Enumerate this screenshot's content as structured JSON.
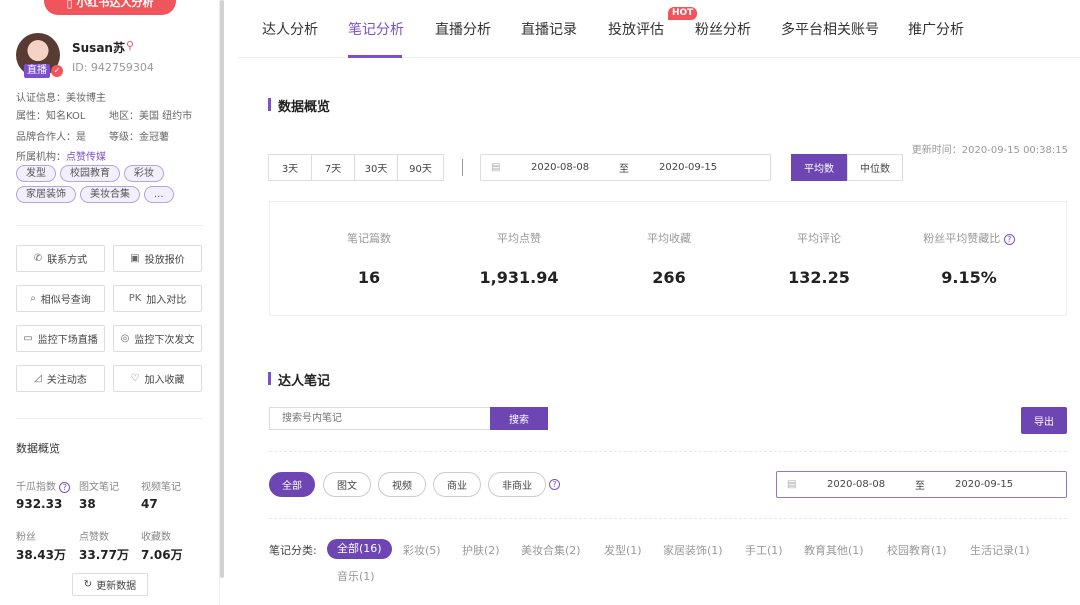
{
  "sidebar": {
    "top_button": "小红书达人分析",
    "profile": {
      "name": "Susan苏",
      "id": "ID: 942759304",
      "live_badge": "直播"
    },
    "info": {
      "cert": {
        "label": "认证信息：",
        "value": "美妆博主"
      },
      "attr": {
        "label": "属性：",
        "value": "知名KOL"
      },
      "region": {
        "label": "地区：",
        "value": "美国 纽约市"
      },
      "brand": {
        "label": "品牌合作人：",
        "value": "是"
      },
      "level": {
        "label": "等级：",
        "value": "金冠薯"
      },
      "org": {
        "label": "所属机构：",
        "value": "点赞传媒"
      }
    },
    "tags": [
      "发型",
      "校园教育",
      "彩妆",
      "家居装饰",
      "美妆合集",
      "..."
    ],
    "buttons": {
      "contact": "联系方式",
      "quote": "投放报价",
      "similar": "相似号查询",
      "compare": "加入对比",
      "monitor_live": "监控下场直播",
      "monitor_post": "监控下次发文",
      "follow": "关注动态",
      "favorite": "加入收藏"
    },
    "data_overview": {
      "title": "数据概览",
      "stats": [
        {
          "label": "千瓜指数",
          "value": "932.33"
        },
        {
          "label": "图文笔记",
          "value": "38"
        },
        {
          "label": "视频笔记",
          "value": "47"
        },
        {
          "label": "粉丝",
          "value": "38.43万"
        },
        {
          "label": "点赞数",
          "value": "33.77万"
        },
        {
          "label": "收藏数",
          "value": "7.06万"
        }
      ],
      "refresh": "更新数据"
    }
  },
  "tabs": [
    {
      "label": "达人分析"
    },
    {
      "label": "笔记分析"
    },
    {
      "label": "直播分析"
    },
    {
      "label": "直播记录"
    },
    {
      "label": "投放评估"
    },
    {
      "label": "粉丝分析"
    },
    {
      "label": "多平台相关账号"
    },
    {
      "label": "推广分析"
    }
  ],
  "hot_badge": "HOT",
  "overview": {
    "title": "数据概览",
    "updated": "更新时间：2020-09-15 00:38:15",
    "ranges": [
      "3天",
      "7天",
      "30天",
      "90天"
    ],
    "date_from": "2020-08-08",
    "date_sep": "至",
    "date_to": "2020-09-15",
    "modes": [
      "平均数",
      "中位数"
    ],
    "metrics": [
      {
        "label": "笔记篇数",
        "value": "16"
      },
      {
        "label": "平均点赞",
        "value": "1,931.94"
      },
      {
        "label": "平均收藏",
        "value": "266"
      },
      {
        "label": "平均评论",
        "value": "132.25"
      },
      {
        "label": "粉丝平均赞藏比",
        "value": "9.15%"
      }
    ]
  },
  "notes": {
    "title": "达人笔记",
    "search_placeholder": "搜索号内笔记",
    "search_btn": "搜索",
    "export_btn": "导出",
    "filters": [
      "全部",
      "图文",
      "视频",
      "商业",
      "非商业"
    ],
    "date_from": "2020-08-08",
    "date_sep": "至",
    "date_to": "2020-09-15",
    "category_label": "笔记分类:",
    "categories": [
      "全部(16)",
      "彩妆(5)",
      "护肤(2)",
      "美妆合集(2)",
      "发型(1)",
      "家居装饰(1)",
      "手工(1)",
      "教育其他(1)",
      "校园教育(1)",
      "生活记录(1)",
      "音乐(1)"
    ]
  },
  "colors": {
    "accent": "#6e46b4",
    "brand_red": "#f0555c"
  }
}
